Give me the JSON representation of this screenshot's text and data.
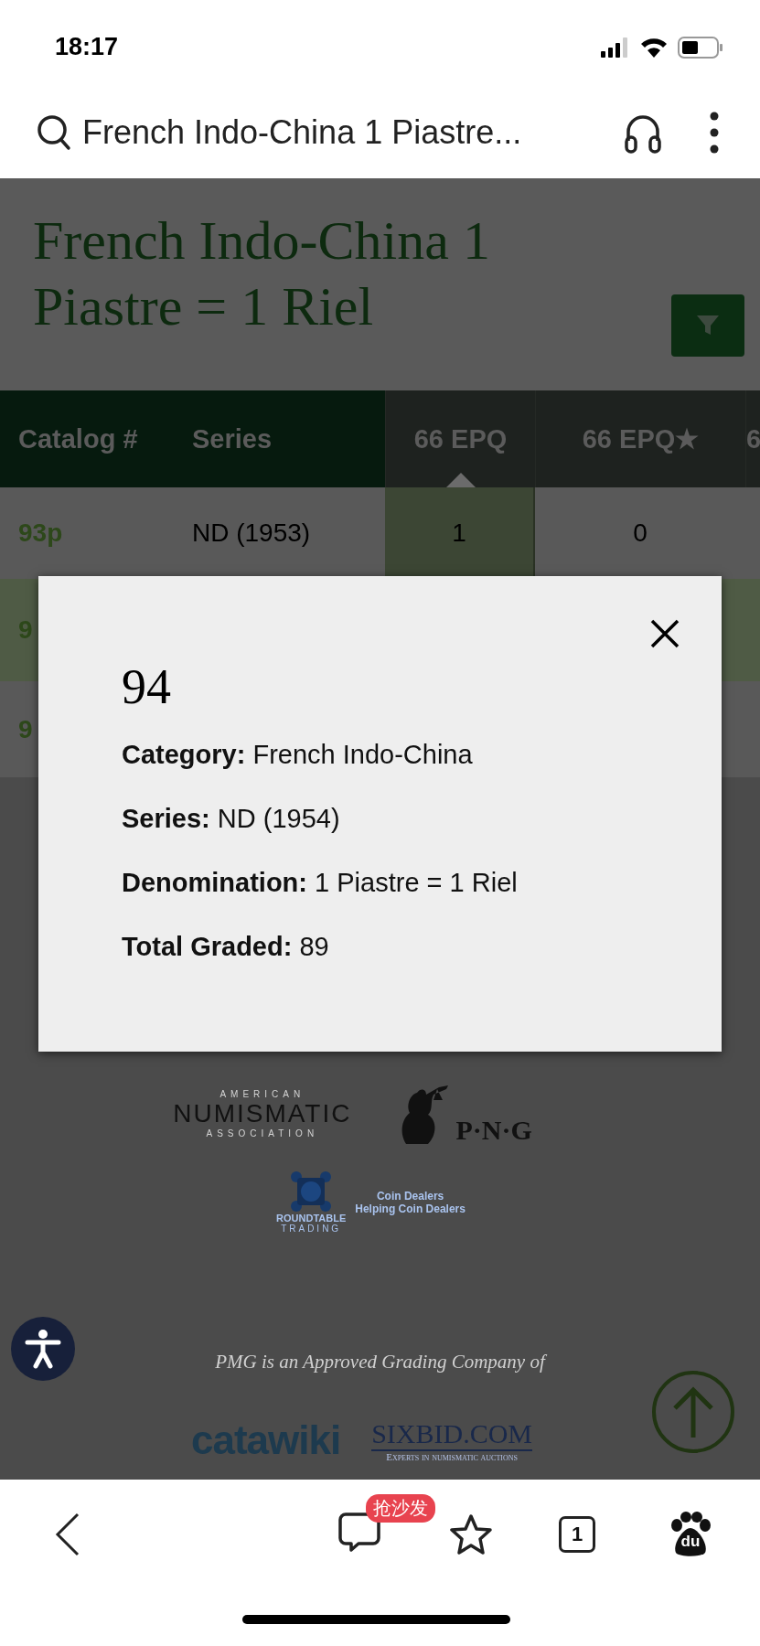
{
  "status_bar": {
    "time": "18:17"
  },
  "browser_bar": {
    "query": "French Indo-China 1 Piastre..."
  },
  "page": {
    "title": "French Indo-China 1 Piastre = 1 Riel",
    "table": {
      "columns": [
        {
          "label": "Catalog #",
          "kind": "info",
          "selected": false
        },
        {
          "label": "Series",
          "kind": "info",
          "selected": false
        },
        {
          "label": "66 EPQ",
          "kind": "grade",
          "selected": true
        },
        {
          "label": "66 EPQ★",
          "kind": "grade",
          "selected": false
        },
        {
          "label": "6",
          "kind": "grade",
          "selected": false
        }
      ],
      "rows": [
        {
          "cells": [
            "93p",
            "ND (1953)",
            "1",
            "0"
          ],
          "selected": false
        },
        {
          "cells": [
            "9"
          ],
          "selected": true
        },
        {
          "cells": [
            "9"
          ],
          "selected": false
        }
      ]
    },
    "footer": {
      "ana": {
        "top": "AMERICAN",
        "main": "NUMISMATIC",
        "bottom": "ASSOCIATION"
      },
      "png": "P·N·G",
      "roundtable": {
        "name": "ROUNDTABLE",
        "sub": "TRADING",
        "tagline": [
          "Coin Dealers",
          "Helping Coin Dealers"
        ]
      },
      "approved_text": "PMG is an Approved Grading Company of",
      "catawiki": "catawiki",
      "sixbid": {
        "name": "SIXBID.COM",
        "tagline": "Experts in numismatic auctions"
      }
    }
  },
  "modal": {
    "title": "94",
    "fields": [
      {
        "label": "Category:",
        "value": "French Indo-China"
      },
      {
        "label": "Series:",
        "value": "ND (1954)"
      },
      {
        "label": "Denomination:",
        "value": "1 Piastre = 1 Riel"
      },
      {
        "label": "Total Graded:",
        "value": "89"
      }
    ]
  },
  "bottom_bar": {
    "badge": "抢沙发",
    "tab_count": "1",
    "baidu_label": "du"
  }
}
